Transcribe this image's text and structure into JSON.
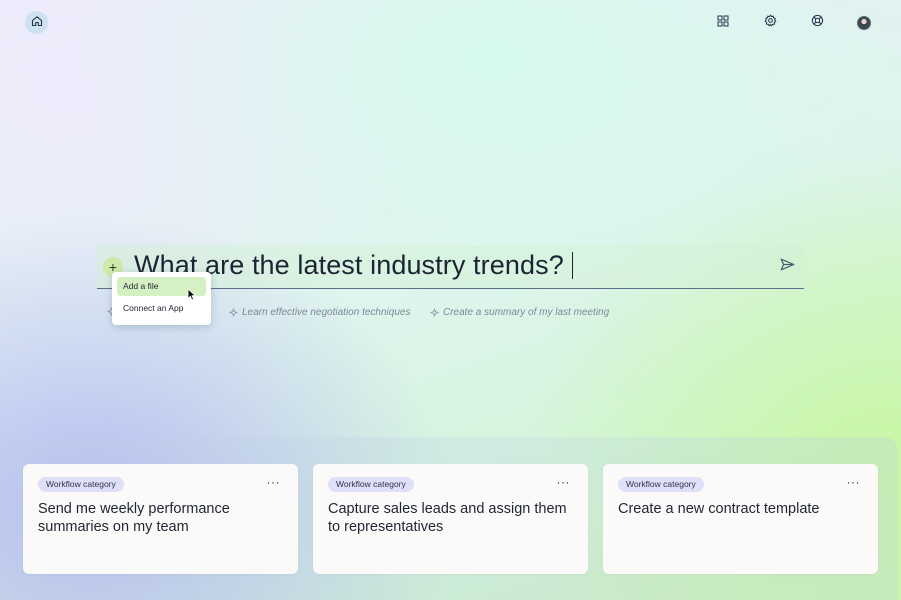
{
  "header": {
    "icons": [
      "home-icon",
      "grid-icon",
      "settings-icon",
      "help-lifebuoy-icon",
      "avatar"
    ]
  },
  "prompt": {
    "text": "What are the latest industry trends?",
    "plus_glyph": "+"
  },
  "suggestions": [
    {
      "label": "Learn effective negotiation techniques"
    },
    {
      "label": "Create a summary of my last meeting"
    }
  ],
  "dropdown": {
    "items": [
      {
        "label": "Add a file"
      },
      {
        "label": "Connect an App"
      }
    ]
  },
  "cards": [
    {
      "badge": "Workflow category",
      "more": "···",
      "title": "Send me weekly performance summaries on my team"
    },
    {
      "badge": "Workflow category",
      "more": "···",
      "title": "Capture sales leads and assign them to representatives"
    },
    {
      "badge": "Workflow category",
      "more": "···",
      "title": "Create a new contract template"
    }
  ],
  "colors": {
    "accent_green": "#cdeaa8",
    "dropdown_active": "#d5f1c4",
    "badge_bg": "#dfe0f7",
    "home_button_bg": "#cde1f0",
    "text": "#1c2433"
  }
}
